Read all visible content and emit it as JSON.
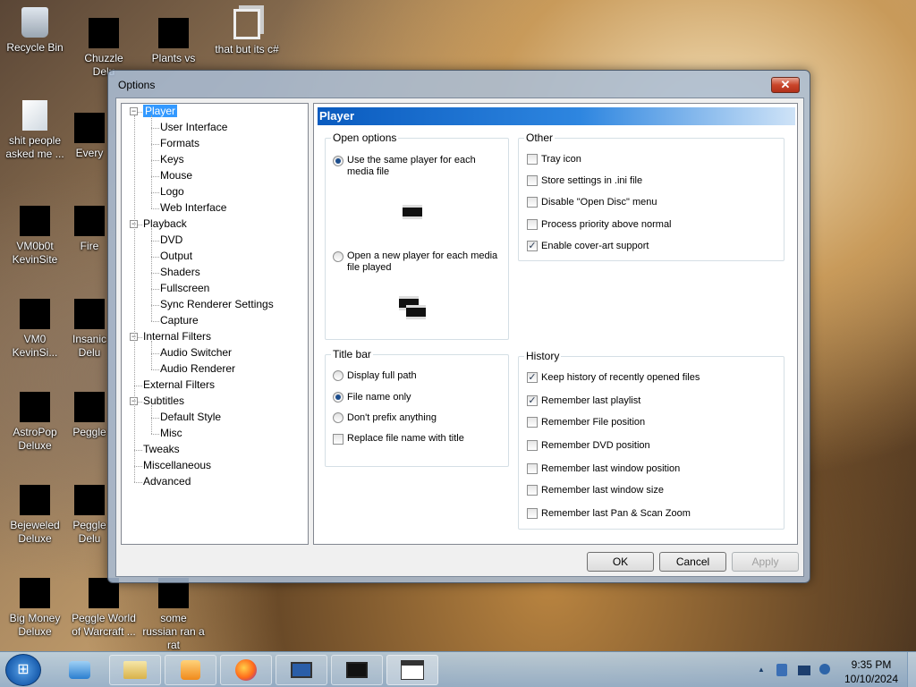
{
  "desktop": {
    "icons": [
      {
        "label": "Recycle Bin"
      },
      {
        "label": "Chuzzle Delu"
      },
      {
        "label": "Plants vs"
      },
      {
        "label": "that but its c#"
      },
      {
        "label": "shit people asked me ..."
      },
      {
        "label": "Every"
      },
      {
        "label": "VM0b0t KevinSite"
      },
      {
        "label": "Fire"
      },
      {
        "label": "VM0 KevinSi..."
      },
      {
        "label": "Insanic Delu"
      },
      {
        "label": "AstroPop Deluxe"
      },
      {
        "label": "Peggle"
      },
      {
        "label": "Bejeweled Deluxe"
      },
      {
        "label": "Peggle Delu"
      },
      {
        "label": "Big Money Deluxe"
      },
      {
        "label": "Peggle World of Warcraft ..."
      },
      {
        "label": "some russian ran a rat"
      }
    ]
  },
  "window": {
    "title": "Options",
    "close_label": "✕",
    "tree": [
      {
        "label": "Player",
        "level": 0,
        "expander": "−",
        "selected": true
      },
      {
        "label": "User Interface",
        "level": 1
      },
      {
        "label": "Formats",
        "level": 1
      },
      {
        "label": "Keys",
        "level": 1
      },
      {
        "label": "Mouse",
        "level": 1
      },
      {
        "label": "Logo",
        "level": 1
      },
      {
        "label": "Web Interface",
        "level": 1
      },
      {
        "label": "Playback",
        "level": 0,
        "expander": "−"
      },
      {
        "label": "DVD",
        "level": 1
      },
      {
        "label": "Output",
        "level": 1
      },
      {
        "label": "Shaders",
        "level": 1
      },
      {
        "label": "Fullscreen",
        "level": 1
      },
      {
        "label": "Sync Renderer Settings",
        "level": 1
      },
      {
        "label": "Capture",
        "level": 1
      },
      {
        "label": "Internal Filters",
        "level": 0,
        "expander": "−"
      },
      {
        "label": "Audio Switcher",
        "level": 1
      },
      {
        "label": "Audio Renderer",
        "level": 1
      },
      {
        "label": "External Filters",
        "level": 0
      },
      {
        "label": "Subtitles",
        "level": 0,
        "expander": "−"
      },
      {
        "label": "Default Style",
        "level": 1
      },
      {
        "label": "Misc",
        "level": 1
      },
      {
        "label": "Tweaks",
        "level": 0
      },
      {
        "label": "Miscellaneous",
        "level": 0
      },
      {
        "label": "Advanced",
        "level": 0
      }
    ],
    "panel": {
      "header": "Player",
      "open_options": {
        "label": "Open options",
        "same_player": {
          "text": "Use the same player for each media file",
          "selected": true
        },
        "new_player": {
          "text": "Open a new player for each media file played",
          "selected": false
        }
      },
      "other": {
        "label": "Other",
        "items": [
          {
            "text": "Tray icon",
            "checked": false
          },
          {
            "text": "Store settings in .ini file",
            "checked": false
          },
          {
            "text": "Disable \"Open Disc\" menu",
            "checked": false
          },
          {
            "text": "Process priority above normal",
            "checked": false
          },
          {
            "text": "Enable cover-art support",
            "checked": true
          }
        ]
      },
      "title_bar": {
        "label": "Title bar",
        "radios": [
          {
            "text": "Display full path",
            "selected": false
          },
          {
            "text": "File name only",
            "selected": true
          },
          {
            "text": "Don't prefix anything",
            "selected": false
          }
        ],
        "replace": {
          "text": "Replace file name with title",
          "checked": false
        }
      },
      "history": {
        "label": "History",
        "items": [
          {
            "text": "Keep history of recently opened files",
            "checked": true
          },
          {
            "text": "Remember last playlist",
            "checked": true
          },
          {
            "text": "Remember File position",
            "checked": false
          },
          {
            "text": "Remember DVD position",
            "checked": false
          },
          {
            "text": "Remember last window position",
            "checked": false
          },
          {
            "text": "Remember last window size",
            "checked": false
          },
          {
            "text": "Remember last Pan & Scan Zoom",
            "checked": false
          }
        ]
      }
    },
    "buttons": {
      "ok": "OK",
      "cancel": "Cancel",
      "apply": "Apply"
    }
  },
  "taskbar": {
    "start_glyph": "⊞",
    "time": "9:35 PM",
    "date": "10/10/2024",
    "tray_chevron": "▲"
  }
}
